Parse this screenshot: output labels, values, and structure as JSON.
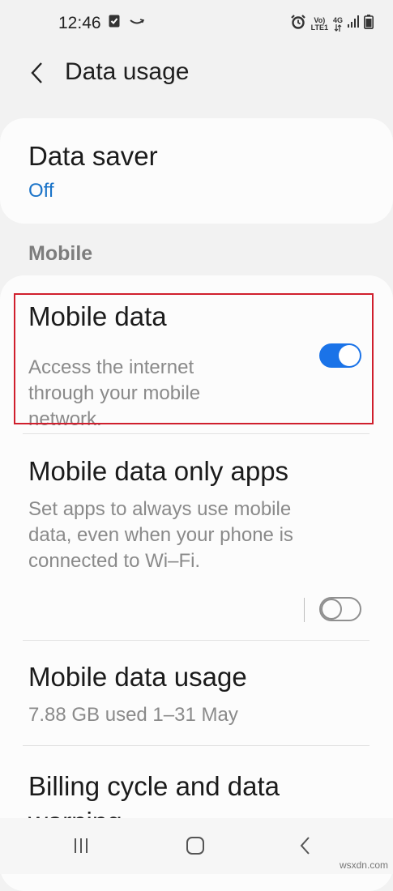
{
  "status_bar": {
    "time": "12:46",
    "left_icons": [
      "screenshot-icon",
      "amazon-icon"
    ],
    "network_label_top": "Vo)",
    "network_label_bottom": "LTE1",
    "network_type": "4G"
  },
  "header": {
    "title": "Data usage",
    "back_icon": "chevron-left-icon"
  },
  "data_saver": {
    "title": "Data saver",
    "value": "Off",
    "value_color": "#1a73c8"
  },
  "section": {
    "mobile_header": "Mobile"
  },
  "mobile_data": {
    "title": "Mobile data",
    "description": "Access the internet through your mobile network.",
    "enabled": true,
    "accent": "#1a73e8",
    "highlight_color": "#d01f2d"
  },
  "mobile_data_only_apps": {
    "title": "Mobile data only apps",
    "description": "Set apps to always use mobile data, even when your phone is connected to Wi–Fi.",
    "enabled": false
  },
  "mobile_data_usage": {
    "title": "Mobile data usage",
    "subtitle": "7.88 GB used 1–31 May"
  },
  "billing": {
    "title": "Billing cycle and data warning"
  },
  "navigation": {
    "recent_icon": "recent-apps-icon",
    "home_icon": "home-icon",
    "back_icon": "back-icon"
  },
  "watermark": "wsxdn.com"
}
